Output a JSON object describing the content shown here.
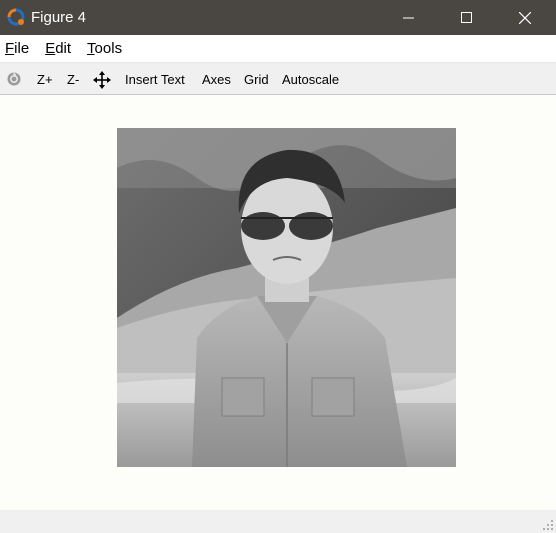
{
  "window": {
    "title": "Figure 4",
    "icons": [
      "app-logo-icon",
      "minimize-icon",
      "maximize-icon",
      "close-icon"
    ]
  },
  "menubar": {
    "items": [
      {
        "label_first": "F",
        "label_rest": "ile"
      },
      {
        "label_first": "E",
        "label_rest": "dit"
      },
      {
        "label_first": "T",
        "label_rest": "ools"
      }
    ]
  },
  "toolbar": {
    "reset_icon": "reset-view-icon",
    "zoom_in": "Z+",
    "zoom_out": "Z-",
    "pan_icon": "pan-move-icon",
    "insert_text": "Insert Text",
    "axes": "Axes",
    "grid": "Grid",
    "autoscale": "Autoscale"
  },
  "figure": {
    "content": "grayscale-photo",
    "background": "#fdfdf9"
  },
  "colors": {
    "titlebar": "#4a4742",
    "toolbar": "#f0f0f0",
    "logo_orange": "#f07c1a",
    "logo_blue": "#1f6fc2"
  }
}
